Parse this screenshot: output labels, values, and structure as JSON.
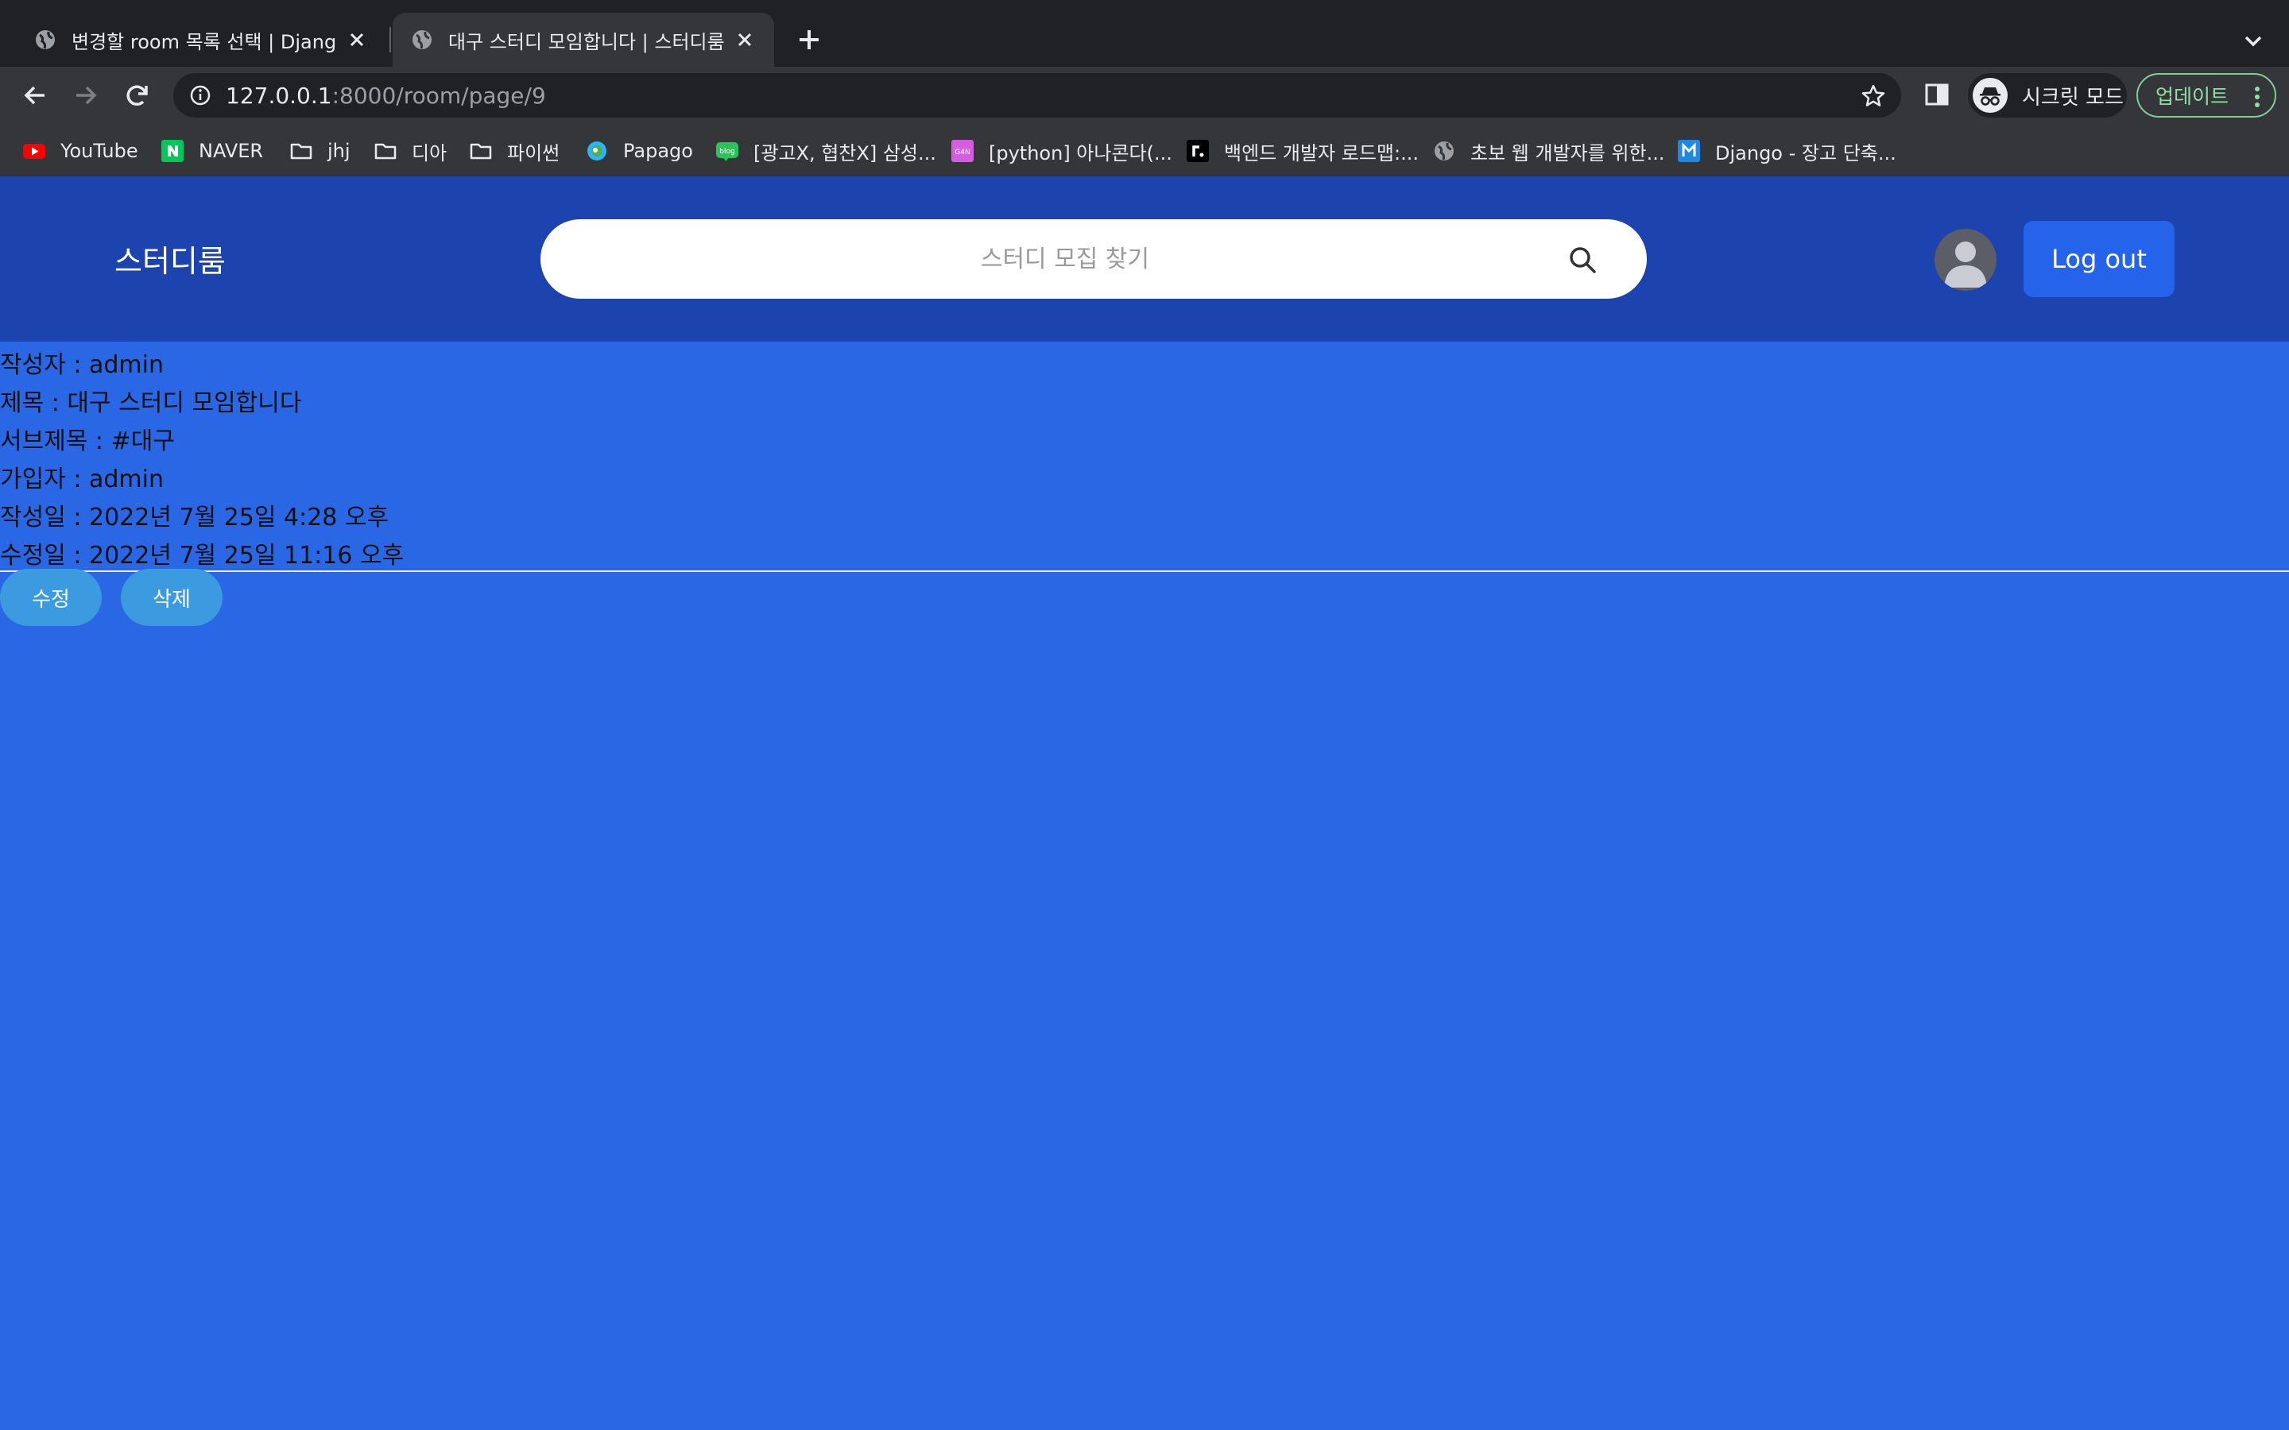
{
  "browser": {
    "tabs": [
      {
        "title": "변경할 room 목록 선택 | Django 사이트 관리"
      },
      {
        "title": "대구 스터디 모임합니다 | 스터디룸"
      }
    ],
    "address": {
      "host": "127.0.0.1",
      "path": ":8000/room/page/9"
    },
    "incognito_label": "시크릿 모드",
    "update_label": "업데이트",
    "bookmarks": [
      {
        "label": "YouTube",
        "icon": "youtube-icon"
      },
      {
        "label": "NAVER",
        "icon": "naver-icon"
      },
      {
        "label": "jhj",
        "icon": "folder-icon"
      },
      {
        "label": "디아",
        "icon": "folder-icon"
      },
      {
        "label": "파이썬",
        "icon": "folder-icon"
      },
      {
        "label": "Papago",
        "icon": "papago-icon"
      },
      {
        "label": "[광고X, 협찬X] 삼성...",
        "icon": "blog-icon"
      },
      {
        "label": "[python] 아나콘다(...",
        "icon": "blog-icon"
      },
      {
        "label": "백엔드 개발자 로드맵:...",
        "icon": "site-icon"
      },
      {
        "label": "초보 웹 개발자를 위한...",
        "icon": "globe-icon"
      },
      {
        "label": "Django - 장고 단축...",
        "icon": "site-icon"
      }
    ],
    "colors": {
      "tabstrip": "#202124",
      "toolbar": "#35363a",
      "update": "#8ee0a4"
    }
  },
  "site": {
    "logo": "스터디룸",
    "search_placeholder": "스터디 모집 찾기",
    "logout_label": "Log out",
    "colors": {
      "header": "#1c43ae",
      "body": "#2a67e5",
      "button": "#2563eb",
      "pill": "#3b9ae0"
    }
  },
  "room": {
    "lines": [
      "작성자 : admin",
      "제목 : 대구 스터디 모임합니다",
      "서브제목 : #대구",
      "가입자 : admin",
      "작성일 : 2022년 7월 25일 4:28 오후",
      "수정일 : 2022년 7월 25일 11:16 오후"
    ],
    "edit_label": "수정",
    "delete_label": "삭제"
  }
}
